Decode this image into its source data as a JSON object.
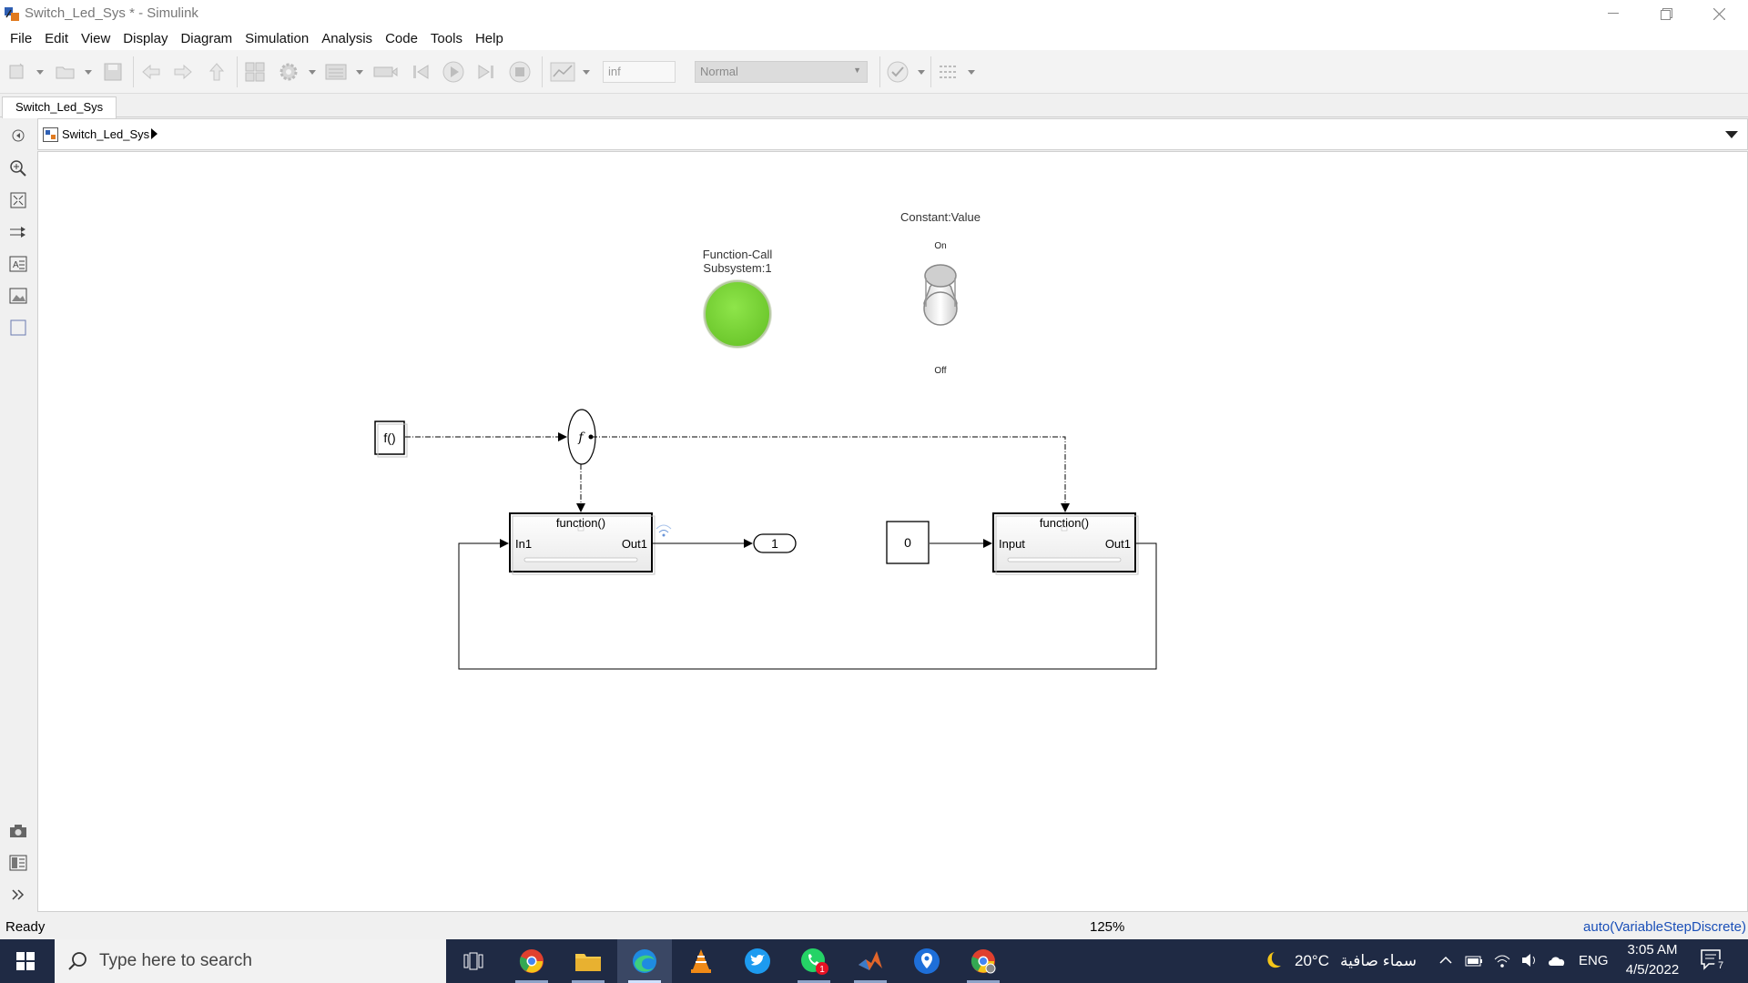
{
  "window": {
    "title": "Switch_Led_Sys * - Simulink",
    "controls": [
      "minimize",
      "restore",
      "close"
    ]
  },
  "menu": [
    "File",
    "Edit",
    "View",
    "Display",
    "Diagram",
    "Simulation",
    "Analysis",
    "Code",
    "Tools",
    "Help"
  ],
  "toolbar": {
    "stop_time": "inf",
    "sim_mode": "Normal"
  },
  "tabs": [
    {
      "label": "Switch_Led_Sys"
    }
  ],
  "address": {
    "crumb": "Switch_Led_Sys"
  },
  "diagram": {
    "lamp": {
      "label_line1": "Function-Call",
      "label_line2": "Subsystem:1",
      "color": "#7ed23a"
    },
    "switch": {
      "label": "Constant:Value",
      "on_label": "On",
      "off_label": "Off"
    },
    "function_call_generator": {
      "text": "f()"
    },
    "split": {
      "text": "f"
    },
    "subsystem_left": {
      "title": "function()",
      "in_port": "In1",
      "out_port": "Out1"
    },
    "subsystem_right": {
      "title": "function()",
      "in_port": "Input",
      "out_port": "Out1"
    },
    "outport": {
      "text": "1"
    },
    "constant": {
      "text": "0"
    }
  },
  "status": {
    "state": "Ready",
    "zoom": "125%",
    "solver": "auto(VariableStepDiscrete)"
  },
  "taskbar": {
    "search_placeholder": "Type here to search",
    "weather_temp": "20°C",
    "weather_desc": "سماء صافية",
    "language": "ENG",
    "time": "3:05 AM",
    "date": "4/5/2022",
    "notifications": "7",
    "whatsapp_badge": "1",
    "apps": [
      "task-view",
      "chrome",
      "file-explorer",
      "edge",
      "vlc",
      "twitter",
      "whatsapp",
      "matlab",
      "maps",
      "chrome-profile"
    ]
  }
}
